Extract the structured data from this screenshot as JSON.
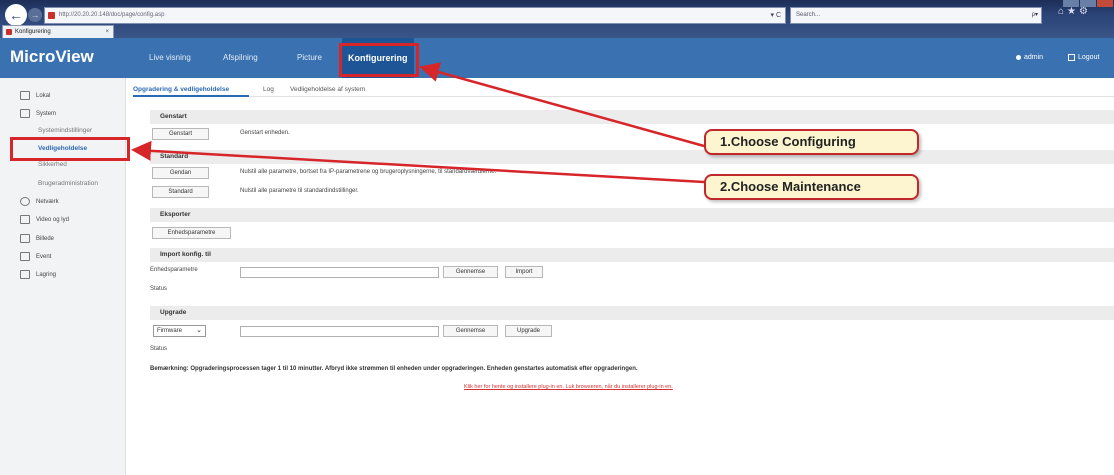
{
  "browser": {
    "url": "http://20.20.20.148/doc/page/config.asp",
    "search_placeholder": "Search...",
    "tab_title": "Konfigurering",
    "tab_close": "×",
    "refresh": "▾ C",
    "search_icon": "ρ▾",
    "chrome_icons": "⌂★⚙"
  },
  "app": {
    "logo": "MicroView",
    "nav": [
      "Live visning",
      "Afspilning",
      "Picture",
      "Konfigurering"
    ],
    "user": "admin",
    "logout": "Logout"
  },
  "sidebar": {
    "items": [
      {
        "label": "Lokal",
        "icon": "monitor-icon"
      },
      {
        "label": "System",
        "icon": "system-icon"
      },
      {
        "label": "Netværk",
        "icon": "network-icon"
      },
      {
        "label": "Video og lyd",
        "icon": "video-audio-icon"
      },
      {
        "label": "Billede",
        "icon": "image-icon"
      },
      {
        "label": "Event",
        "icon": "event-icon"
      },
      {
        "label": "Lagring",
        "icon": "storage-icon"
      }
    ],
    "system_sub": [
      "Systemindstillinger",
      "Vedligeholdelse",
      "Sikkerhed",
      "Brugeradministration"
    ]
  },
  "subtabs": [
    "Opgradering & vedligeholdelse",
    "Log",
    "Vedligeholdelse af system"
  ],
  "sections": {
    "restart": {
      "title": "Genstart",
      "button": "Genstart",
      "desc": "Genstart enheden."
    },
    "default": {
      "title": "Standard",
      "restore_button": "Gendan",
      "restore_desc": "Nulstil alle parametre, bortset fra IP-parametrene og brugeroplysningerne, til standardværdierne.",
      "default_button": "Standard",
      "default_desc": "Nulstil alle parametre til standardindstillinger."
    },
    "export": {
      "title": "Eksporter",
      "button": "Enhedsparametre"
    },
    "import": {
      "title": "Import konfig. til",
      "label": "Enhedsparametre",
      "browse": "Gennemse",
      "import": "Import",
      "status": "Status"
    },
    "upgrade": {
      "title": "Upgrade",
      "select_value": "Firmware",
      "browse": "Gennemse",
      "upgrade": "Upgrade",
      "status": "Status"
    }
  },
  "note": "Bemærkning: Opgraderingsprocessen tager 1 til 10 minutter. Afbryd ikke strømmen til enheden under opgraderingen. Enheden genstartes automatisk efter opgraderingen.",
  "plugin_link": "Klik her for hente og installere plug-in en. Luk browseren, når du installerer plug-in en.",
  "callouts": {
    "step1": "1.Choose Configuring",
    "step2": "2.Choose Maintenance"
  },
  "colors": {
    "header": "#3a71b0",
    "active_nav": "#1e5596",
    "highlight": "#d6262a",
    "callout_fill": "#fdf5cf",
    "link": "#d53030"
  }
}
